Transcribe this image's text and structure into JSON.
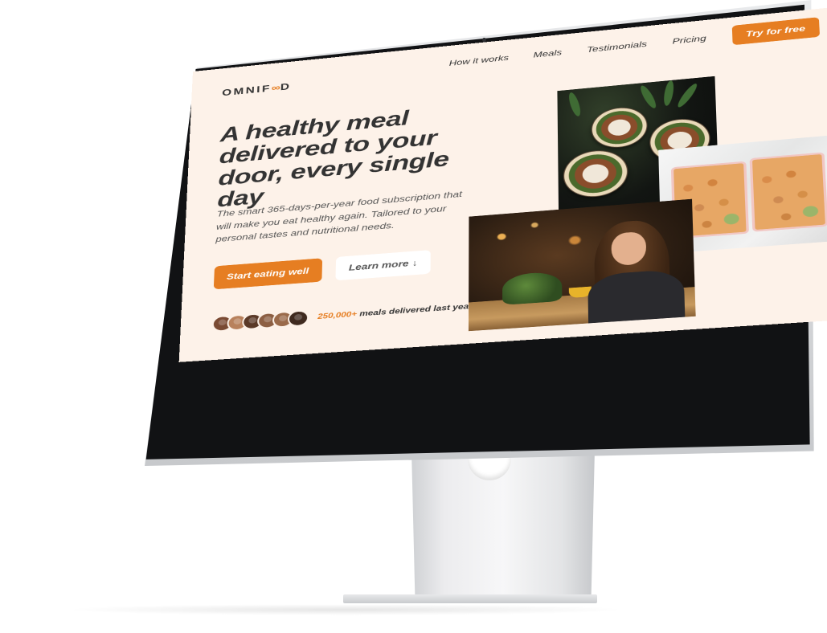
{
  "brand": {
    "name_start": "OMNIF",
    "name_end": "D",
    "logo_icon": "infinity-icon",
    "accent_color": "#e67e22",
    "background_color": "#fdf2e9",
    "text_color": "#333333"
  },
  "nav": {
    "links": [
      "How it works",
      "Meals",
      "Testimonials",
      "Pricing"
    ],
    "cta_label": "Try for free"
  },
  "hero": {
    "title": "A healthy meal delivered to your door, every single day",
    "description": "The smart 365-days-per-year food subscription that will make you eat healthy again. Tailored to your personal tastes and nutritional needs.",
    "primary_button": "Start eating well",
    "secondary_button": "Learn more",
    "secondary_button_icon": "arrow-down-icon",
    "delivered_count": "250,000+",
    "delivered_text": "meals delivered last year!",
    "customer_avatar_count": 6,
    "avatar_colors": [
      "#7a4a33",
      "#b8815c",
      "#5b3a28",
      "#8c5f43",
      "#9a6a4a",
      "#3f2a1f"
    ]
  }
}
